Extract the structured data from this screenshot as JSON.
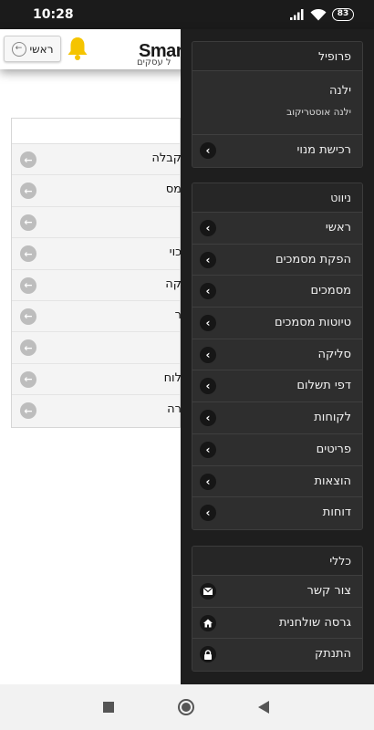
{
  "status_bar": {
    "time": "10:28",
    "battery": "83",
    "icons": [
      "signal-icon",
      "wifi-icon",
      "battery-icon"
    ]
  },
  "header": {
    "home_label": "ראשי",
    "brand": "Smar",
    "brand_sub": "ל עסקים"
  },
  "page_list": {
    "rows": [
      "קבלה",
      "מס",
      "",
      "כוי",
      "קה",
      "ר",
      "",
      "לוח",
      "רה"
    ]
  },
  "menu": {
    "profile": {
      "title": "פרופיל",
      "name": "ילנה",
      "company": "ילנה אוסטריקוב",
      "purchase_label": "רכישת מנוי"
    },
    "navigation": {
      "title": "ניווט",
      "items": [
        "ראשי",
        "הפקת מסמכים",
        "מסמכים",
        "טיוטות מסמכים",
        "סליקה",
        "דפי תשלום",
        "לקוחות",
        "פריטים",
        "הוצאות",
        "דוחות"
      ]
    },
    "general": {
      "title": "כללי",
      "items": [
        {
          "label": "צור קשר",
          "icon": "envelope-icon"
        },
        {
          "label": "גרסה שולחנית",
          "icon": "home-icon"
        },
        {
          "label": "התנתק",
          "icon": "lock-icon"
        }
      ]
    }
  },
  "colors": {
    "menu_bg": "#1e1e1e",
    "menu_card": "#2e2e2e",
    "bell": "#f5c400",
    "status_bar": "#1b1b1b"
  }
}
